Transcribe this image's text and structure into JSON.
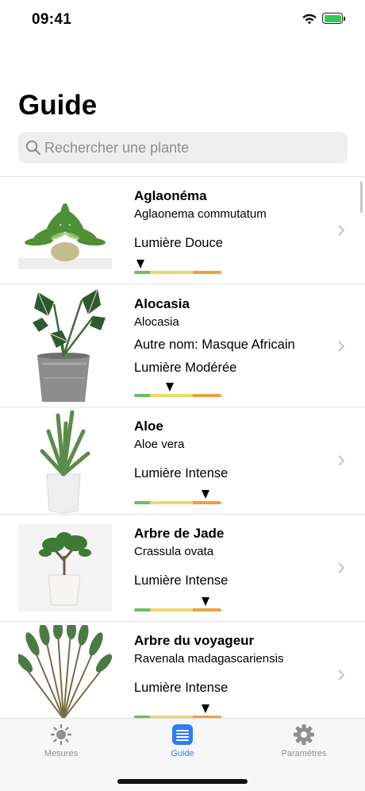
{
  "status_bar": {
    "time": "09:41"
  },
  "page": {
    "title": "Guide"
  },
  "search": {
    "placeholder": "Rechercher une plante"
  },
  "plants": [
    {
      "name": "Aglaonéma",
      "scientific": "Aglaonema commutatum",
      "other_name": "",
      "light": "Lumière Douce",
      "light_level": 0.08
    },
    {
      "name": "Alocasia",
      "scientific": "Alocasia",
      "other_name": "Autre nom: Masque Africain",
      "light": "Lumière Modérée",
      "light_level": 0.41
    },
    {
      "name": "Aloe",
      "scientific": "Aloe vera",
      "other_name": "",
      "light": "Lumière Intense",
      "light_level": 0.82
    },
    {
      "name": "Arbre de Jade",
      "scientific": "Crassula ovata",
      "other_name": "",
      "light": "Lumière Intense",
      "light_level": 0.82
    },
    {
      "name": "Arbre du voyageur",
      "scientific": "Ravenala madagascariensis",
      "other_name": "",
      "light": "Lumière Intense",
      "light_level": 0.82
    }
  ],
  "tabs": [
    {
      "label": "Mesures",
      "icon": "sun-icon",
      "active": false
    },
    {
      "label": "Guide",
      "icon": "list-icon",
      "active": true
    },
    {
      "label": "Paramètres",
      "icon": "gear-icon",
      "active": false
    }
  ],
  "colors": {
    "accent": "#2f7df6",
    "inactive": "#8e8e93",
    "meter_low": "#6bbf67",
    "meter_mid": "#e9d96b",
    "meter_high": "#eba144"
  }
}
